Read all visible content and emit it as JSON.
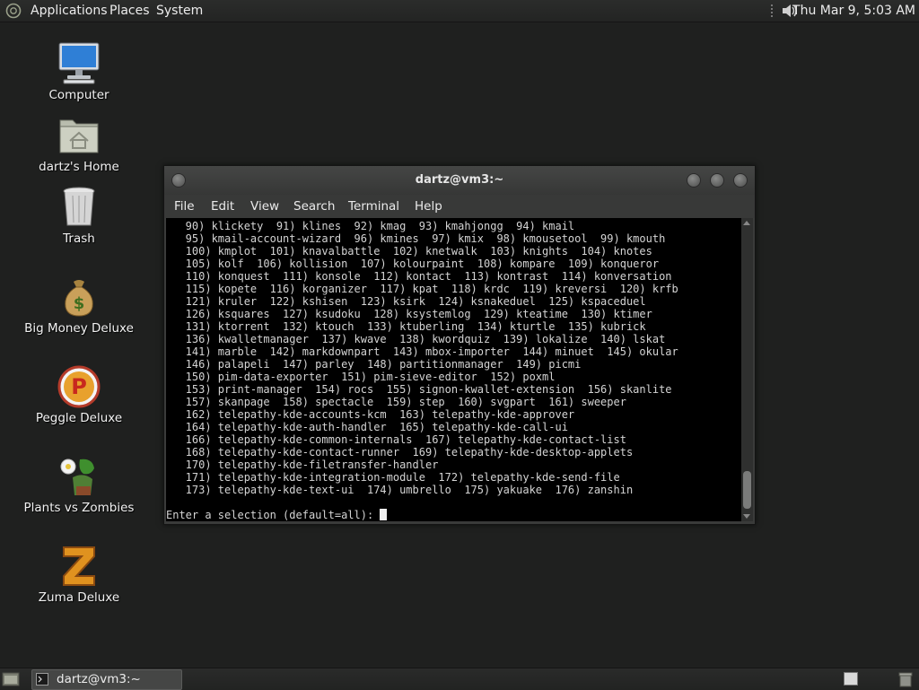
{
  "top_panel": {
    "menus": [
      "Applications",
      "Places",
      "System"
    ],
    "clock": "Thu Mar  9,  5:03 AM",
    "icons": {
      "logo": "distro-logo-icon",
      "volume": "volume-icon"
    }
  },
  "desktop_icons": [
    {
      "label": "Computer",
      "icon": "computer-icon"
    },
    {
      "label": "dartz's Home",
      "icon": "home-folder-icon"
    },
    {
      "label": "Trash",
      "icon": "trash-icon"
    },
    {
      "label": "Big Money Deluxe",
      "icon": "money-bag-icon"
    },
    {
      "label": "Peggle Deluxe",
      "icon": "peggle-icon"
    },
    {
      "label": "Plants vs Zombies",
      "icon": "plants-vs-zombies-icon"
    },
    {
      "label": "Zuma Deluxe",
      "icon": "zuma-icon"
    }
  ],
  "terminal": {
    "title": "dartz@vm3:~",
    "menu": [
      "File",
      "Edit",
      "View",
      "Search",
      "Terminal",
      "Help"
    ],
    "lines": [
      "   90) klickety  91) klines  92) kmag  93) kmahjongg  94) kmail",
      "   95) kmail-account-wizard  96) kmines  97) kmix  98) kmousetool  99) kmouth",
      "   100) kmplot  101) knavalbattle  102) knetwalk  103) knights  104) knotes",
      "   105) kolf  106) kollision  107) kolourpaint  108) kompare  109) konqueror",
      "   110) konquest  111) konsole  112) kontact  113) kontrast  114) konversation",
      "   115) kopete  116) korganizer  117) kpat  118) krdc  119) kreversi  120) krfb",
      "   121) kruler  122) kshisen  123) ksirk  124) ksnakeduel  125) kspaceduel",
      "   126) ksquares  127) ksudoku  128) ksystemlog  129) kteatime  130) ktimer",
      "   131) ktorrent  132) ktouch  133) ktuberling  134) kturtle  135) kubrick",
      "   136) kwalletmanager  137) kwave  138) kwordquiz  139) lokalize  140) lskat",
      "   141) marble  142) markdownpart  143) mbox-importer  144) minuet  145) okular",
      "   146) palapeli  147) parley  148) partitionmanager  149) picmi",
      "   150) pim-data-exporter  151) pim-sieve-editor  152) poxml",
      "   153) print-manager  154) rocs  155) signon-kwallet-extension  156) skanlite",
      "   157) skanpage  158) spectacle  159) step  160) svgpart  161) sweeper",
      "   162) telepathy-kde-accounts-kcm  163) telepathy-kde-approver",
      "   164) telepathy-kde-auth-handler  165) telepathy-kde-call-ui",
      "   166) telepathy-kde-common-internals  167) telepathy-kde-contact-list",
      "   168) telepathy-kde-contact-runner  169) telepathy-kde-desktop-applets",
      "   170) telepathy-kde-filetransfer-handler",
      "   171) telepathy-kde-integration-module  172) telepathy-kde-send-file",
      "   173) telepathy-kde-text-ui  174) umbrello  175) yakuake  176) zanshin"
    ],
    "prompt": "Enter a selection (default=all): "
  },
  "bottom_panel": {
    "task_label": "dartz@vm3:~"
  }
}
